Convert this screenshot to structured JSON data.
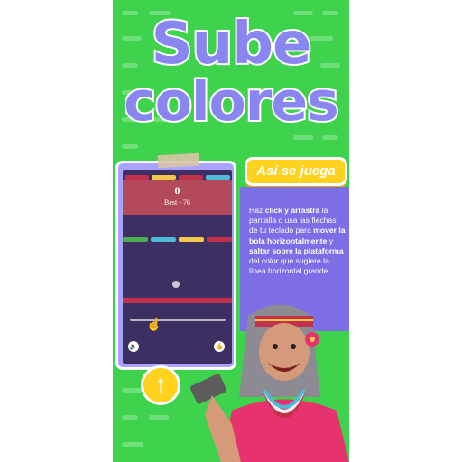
{
  "title": {
    "line1": "Sube",
    "line2": "colores"
  },
  "game": {
    "score": "0",
    "best": "Best - 76",
    "top_bars": [
      "#c2314b",
      "#f2c94c",
      "#c2314b",
      "#52b8d8"
    ],
    "row_bars": [
      "#4caf50",
      "#52b8d8",
      "#f2c94c",
      "#c2314b"
    ],
    "platform_color": "#c2314b",
    "sound_icon": "speaker-icon",
    "like_icon": "thumbs-up-icon"
  },
  "howto": {
    "button_label": "Así se juega",
    "t1": "Haz ",
    "b1": "click y arrastra",
    "t2": " la pantalla o usa las flechas de tu teclado para ",
    "b2": "mover la bola horizontalmente",
    "t3": " y ",
    "b3": "saltar sobre la plataforma",
    "t4": " del color que sugiere la línea horizontal grande."
  },
  "controls": {
    "up_icon": "up-arrow-icon"
  },
  "colors": {
    "background": "#3fd24c",
    "title": "#8a86f0",
    "card": "#7b6ee6",
    "button": "#ffd21f"
  }
}
